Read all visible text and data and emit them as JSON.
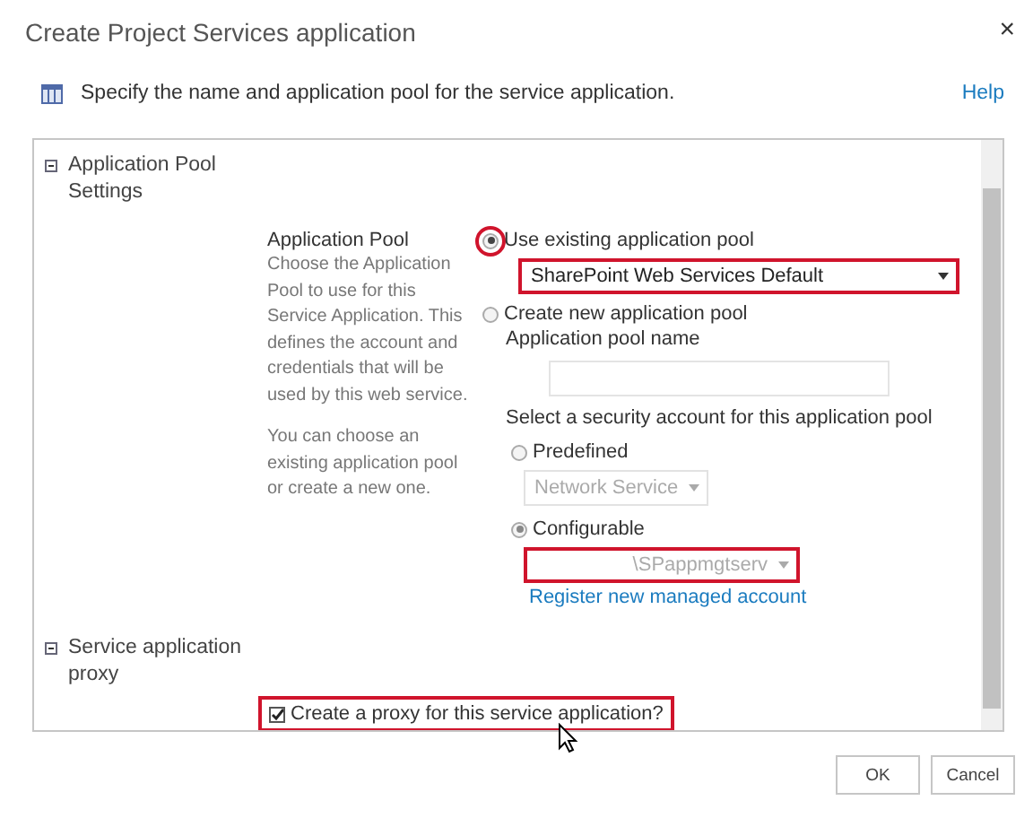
{
  "dialog": {
    "title": "Create Project Services application",
    "close": "×"
  },
  "intro": {
    "text": "Specify the name and application pool for the service application.",
    "help": "Help"
  },
  "sections": [
    {
      "title": "Application Pool Settings",
      "expanded": true,
      "field_title": "Application Pool",
      "description": [
        "Choose the Application Pool to use for this Service Application.  This defines the account and credentials that will be used by this web service.",
        "You can choose an existing application pool or create a new one."
      ],
      "existing": {
        "label": "Use existing application pool",
        "selected": true,
        "highlighted": true,
        "dropdown": {
          "value": "SharePoint Web Services Default",
          "highlighted": true,
          "disabled": false
        }
      },
      "create_new": {
        "label": "Create new application pool",
        "selected": false,
        "name_label": "Application pool name",
        "account_label": "Select a security account for this application pool",
        "accounts": [
          {
            "label": "Predefined",
            "selected": false,
            "dropdown": {
              "value": "Network Service",
              "highlighted": false,
              "disabled": true
            }
          },
          {
            "label": "Configurable",
            "selected": true,
            "dropdown": {
              "value": "\\SPappmgtserv",
              "highlighted": true,
              "disabled": true
            }
          }
        ],
        "link": "Register new managed account"
      }
    },
    {
      "title": "Service application proxy",
      "expanded": true,
      "checkbox": {
        "label": "Create a proxy for this service application?",
        "checked": true,
        "highlighted": true
      }
    }
  ],
  "buttons": [
    "OK",
    "Cancel"
  ]
}
